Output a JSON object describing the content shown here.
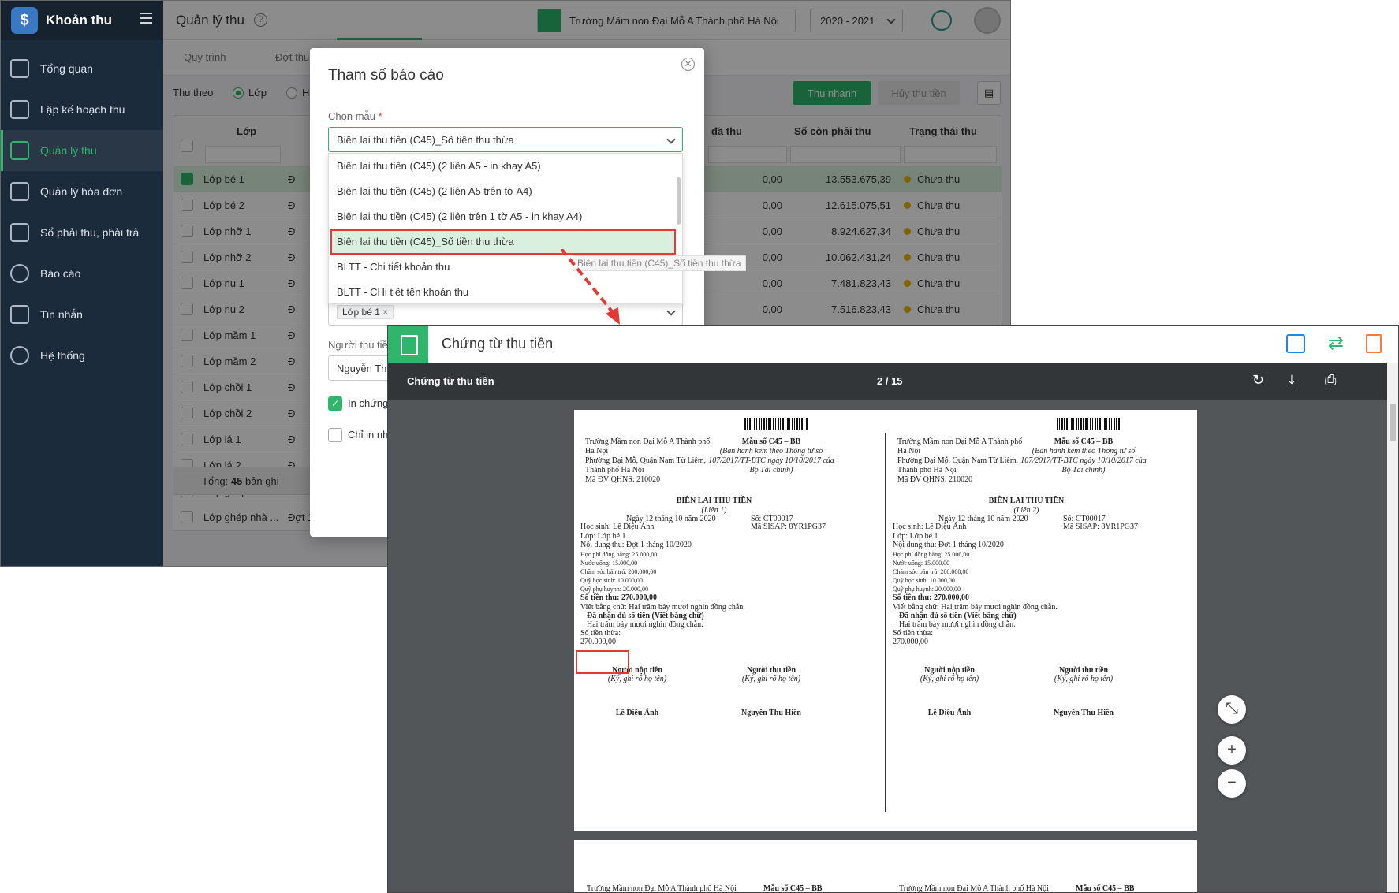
{
  "sidebar": {
    "brand": "Khoản thu",
    "items": [
      {
        "label": "Tổng quan",
        "icon": "chart-icon"
      },
      {
        "label": "Lập kế hoạch thu",
        "icon": "calendar-icon"
      },
      {
        "label": "Quản lý thu",
        "icon": "money-hand-icon"
      },
      {
        "label": "Quản lý hóa đơn",
        "icon": "invoice-icon"
      },
      {
        "label": "Sổ phải thu, phải trả",
        "icon": "ledger-icon"
      },
      {
        "label": "Báo cáo",
        "icon": "pie-icon"
      },
      {
        "label": "Tin nhắn",
        "icon": "message-icon"
      },
      {
        "label": "Hệ thống",
        "icon": "gear-icon"
      }
    ]
  },
  "header": {
    "title": "Quản lý thu",
    "school": "Trường Mầm non Đại Mỗ A Thành phố Hà Nội",
    "year": "2020 - 2021"
  },
  "tabs": [
    "Quy trình",
    "Đợt thu"
  ],
  "filter": {
    "label": "Thu theo",
    "option1": "Lớp",
    "option2": "H"
  },
  "actions": {
    "quick_collect": "Thu nhanh",
    "cancel_collect": "Hủy thu tiền"
  },
  "table": {
    "headers": {
      "class": "Lớp",
      "collected": "đã thu",
      "remaining": "Số còn phải thu",
      "status": "Trạng thái thu"
    },
    "rows": [
      {
        "class": "Lớp bé 1",
        "c2": "Đ",
        "collected": "0,00",
        "remaining": "13.553.675,39",
        "status": "Chưa thu",
        "checked": true
      },
      {
        "class": "Lớp bé 2",
        "c2": "Đ",
        "collected": "0,00",
        "remaining": "12.615.075,51",
        "status": "Chưa thu"
      },
      {
        "class": "Lớp nhỡ 1",
        "c2": "Đ",
        "collected": "0,00",
        "remaining": "8.924.627,34",
        "status": "Chưa thu"
      },
      {
        "class": "Lớp nhỡ 2",
        "c2": "Đ",
        "collected": "0,00",
        "remaining": "10.062.431,24",
        "status": "Chưa thu"
      },
      {
        "class": "Lớp nụ 1",
        "c2": "Đ",
        "collected": "0,00",
        "remaining": "7.481.823,43",
        "status": "Chưa thu"
      },
      {
        "class": "Lớp nụ 2",
        "c2": "Đ",
        "collected": "0,00",
        "remaining": "7.516.823,43",
        "status": "Chưa thu"
      },
      {
        "class": "Lớp mầm 1",
        "c2": "Đ"
      },
      {
        "class": "Lớp mầm 2",
        "c2": "Đ"
      },
      {
        "class": "Lớp chồi 1",
        "c2": "Đ"
      },
      {
        "class": "Lớp chồi 2",
        "c2": "Đ"
      },
      {
        "class": "Lớp lá 1",
        "c2": "Đ"
      },
      {
        "class": "Lớp lá 2",
        "c2": "Đ"
      },
      {
        "class": "Lớp ghép nhà ...",
        "c2": "Đ"
      },
      {
        "class": "Lớp ghép nhà ...",
        "c2": "Đợt 1 tháng ..."
      }
    ],
    "total_prefix": "Tổng: ",
    "total_count": "45",
    "total_suffix": " bản ghi"
  },
  "modal": {
    "title": "Tham số báo cáo",
    "template_label": "Chọn mẫu",
    "required_mark": "*",
    "template_value": "Biên lai thu tiền (C45)_Số tiền thu thừa",
    "options": [
      "Biên lai thu tiền (C45) (2 liên A5 - in khay A5)",
      "Biên lai thu tiền (C45) (2 liên A5 trên tờ A4)",
      "Biên lai thu tiền (C45) (2 liên trên 1 tờ A5 - in khay A4)",
      "Biên lai thu tiền (C45)_Số tiền thu thừa",
      "BLTT - Chi tiết khoản thu",
      "BLTT - CHi tiết tên khoản thu"
    ],
    "tooltip": "Biên lai thu tiền (C45)_Số tiền thu thừa",
    "class_tag": "Lớp bé 1",
    "collector_label": "Người thu tiền",
    "collector_value": "Nguyễn Th",
    "check1": "In chứng",
    "check2": "Chỉ in nh"
  },
  "viewer": {
    "title": "Chứng từ thu tiền",
    "bar_title": "Chứng từ thu tiền",
    "page": "2 / 15"
  },
  "receipt": {
    "school": "Trường Mầm non Đại Mỗ A Thành phố Hà Nội",
    "address": "Phường Đại Mỗ, Quận Nam Từ Liêm, Thành phố Hà Nội",
    "unit_code": "Mã ĐV QHNS: 210020",
    "form": "Mẫu số C45 – BB",
    "form_note": "(Ban hành kèm theo Thông tư số 107/2017/TT-BTC ngày 10/10/2017 của Bộ Tài chính)",
    "heading": "BIÊN LAI THU TIỀN",
    "copy1": "(Liên 1)",
    "copy2": "(Liên 2)",
    "date": "Ngày 12 tháng 10 năm 2020",
    "number": "Số: CT00017",
    "sisap": "Mã SISAP: 8YR1PG37",
    "student": "Học sinh: Lê Diệu Ánh",
    "class": "Lớp: Lớp bé 1",
    "content": "Nội dung thu: Đợt 1 tháng 10/2020",
    "fees": [
      "Học phí đồng bằng: 25.000,00",
      "Nước uống: 15.000,00",
      "Chăm sóc bán trú: 200.000,00",
      "Quỹ học sinh: 10.000,00",
      "Quỹ phụ huynh: 20.000,00"
    ],
    "amount": "Số tiền thu: 270.000,00",
    "in_words": "Viết bằng chữ: Hai trăm bảy mươi nghìn đồng chẵn.",
    "received": "Đã nhận đủ số tiền (Viết bằng chữ)",
    "received_words": "Hai trăm bảy mươi nghìn đồng chẵn.",
    "excess_label": "Số tiền thừa:",
    "excess_value": "270.000,00",
    "payer": "Người nộp tiền",
    "collector": "Người thu tiền",
    "sign_note": "(Ký, ghi rõ họ tên)",
    "payer_name": "Lê Diệu Ánh",
    "collector_name": "Nguyễn Thu Hiền"
  }
}
